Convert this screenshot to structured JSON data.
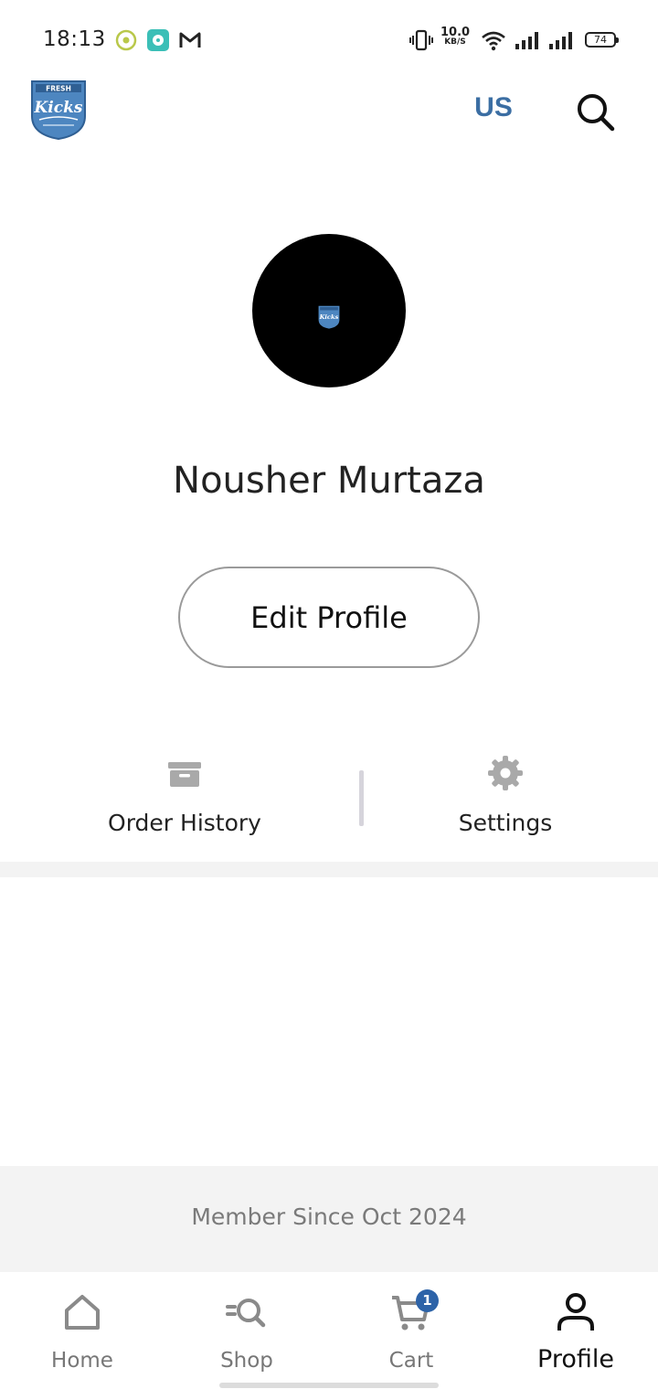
{
  "status_bar": {
    "time": "18:13",
    "net_speed_value": "10.0",
    "net_speed_unit": "KB/S",
    "battery": "74",
    "icons": [
      "record-icon",
      "chat-app-icon",
      "gmail-icon",
      "vibrate-icon",
      "wifi-icon",
      "signal-icon",
      "signal-icon"
    ]
  },
  "header": {
    "logo_text": "FRESH Kicks",
    "region": "US",
    "search_icon": "search-icon"
  },
  "profile": {
    "name": "Nousher Murtaza",
    "edit_button": "Edit Profile"
  },
  "options": [
    {
      "label": "Order History",
      "icon": "archive-box-icon"
    },
    {
      "label": "Settings",
      "icon": "gear-icon"
    }
  ],
  "member_since": "Member Since Oct 2024",
  "bottom_nav": {
    "items": [
      {
        "label": "Home",
        "icon": "home-icon",
        "active": false
      },
      {
        "label": "Shop",
        "icon": "shop-search-icon",
        "active": false
      },
      {
        "label": "Cart",
        "icon": "cart-icon",
        "active": false
      },
      {
        "label": "Profile",
        "icon": "user-icon",
        "active": true
      }
    ],
    "cart_count": "1"
  },
  "colors": {
    "brand_blue": "#3b6ea3",
    "badge_blue": "#2d63a8",
    "band_gray": "#f3f3f3"
  }
}
